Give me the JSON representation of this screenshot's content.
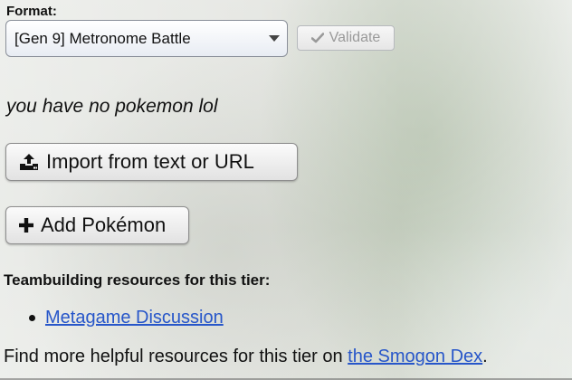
{
  "format": {
    "label": "Format:",
    "selected": "[Gen 9] Metronome Battle"
  },
  "validate": {
    "label": "Validate",
    "icon": "check-icon"
  },
  "team": {
    "empty_message": "you have no pokemon lol"
  },
  "buttons": {
    "import_label": "Import from text or URL",
    "import_icon": "upload-icon",
    "add_label": "Add Pokémon",
    "add_icon": "plus-icon"
  },
  "resources": {
    "heading": "Teambuilding resources for this tier:",
    "links": [
      {
        "label": "Metagame Discussion"
      }
    ]
  },
  "footer": {
    "text": "Find more helpful resources for this tier on ",
    "link": "the Smogon Dex",
    "suffix": "."
  },
  "colors": {
    "link": "#2756c9",
    "validate_disabled": "#9a9a9a"
  }
}
